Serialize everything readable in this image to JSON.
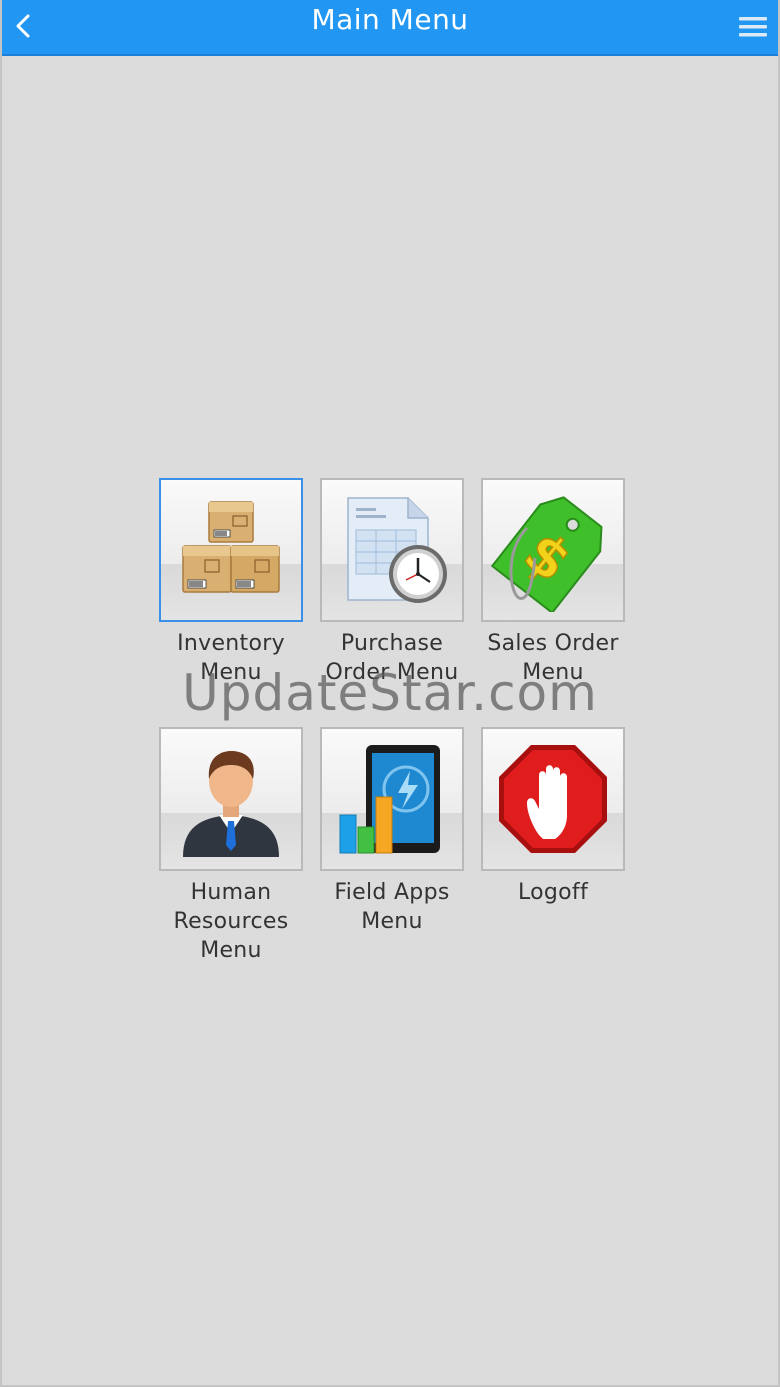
{
  "header": {
    "title": "Main Menu",
    "back_icon": "chevron-left-icon",
    "menu_icon": "hamburger-menu-icon"
  },
  "tiles": [
    {
      "id": "inventory",
      "label": "Inventory Menu",
      "icon": "boxes-icon",
      "selected": true
    },
    {
      "id": "purchase-order",
      "label": "Purchase Order Menu",
      "icon": "document-clock-icon"
    },
    {
      "id": "sales-order",
      "label": "Sales Order Menu",
      "icon": "price-tag-dollar-icon"
    },
    {
      "id": "human-resources",
      "label": "Human Resources Menu",
      "icon": "businessman-icon"
    },
    {
      "id": "field-apps",
      "label": "Field Apps Menu",
      "icon": "tablet-chart-icon"
    },
    {
      "id": "logoff",
      "label": "Logoff",
      "icon": "stop-hand-icon"
    }
  ],
  "watermark": "UpdateStar.com",
  "colors": {
    "header_bg": "#2196f3",
    "background": "#dcdcdc",
    "selected_border": "#3a8fe8"
  }
}
